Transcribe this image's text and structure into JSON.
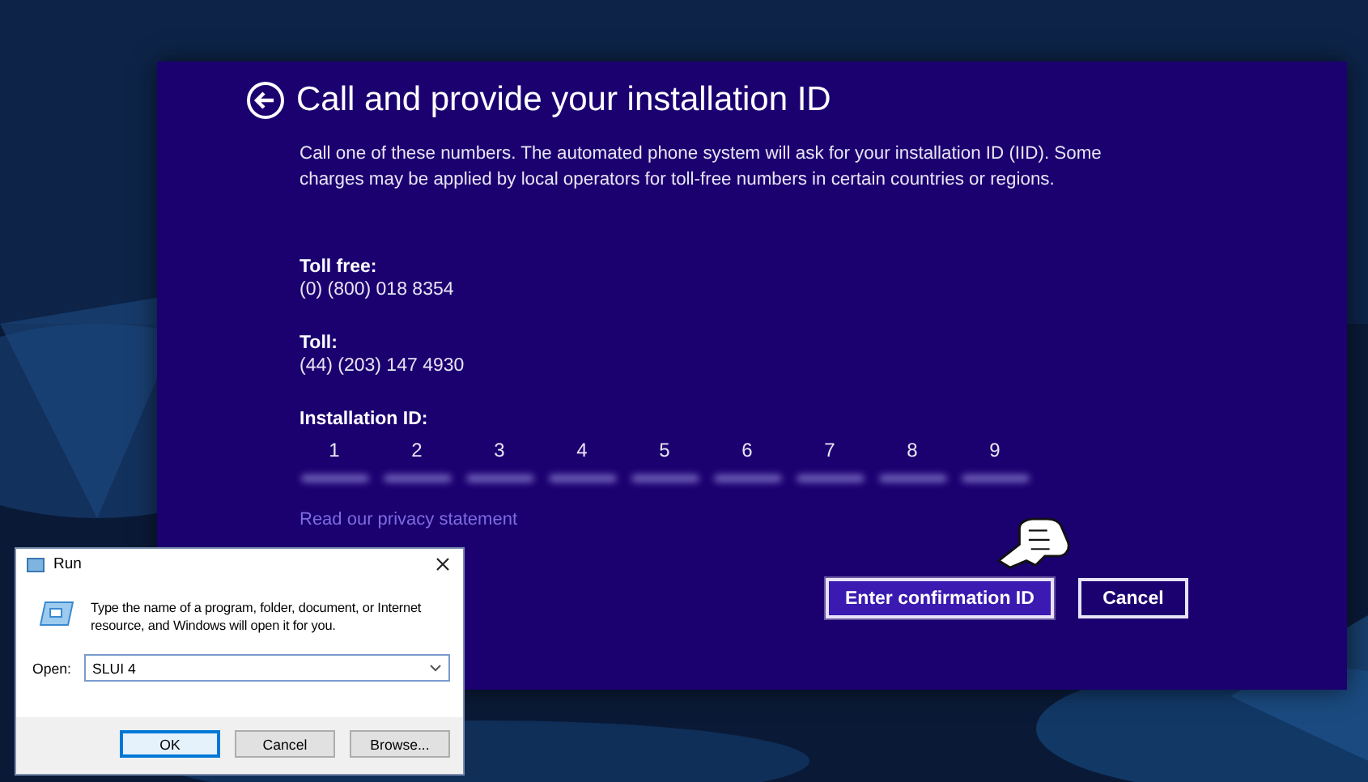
{
  "activation_window": {
    "title": "Call and provide your installation ID",
    "description": "Call one of these numbers. The automated phone system will ask for your installation ID (IID). Some charges may be applied by local operators for toll-free numbers in certain countries or regions.",
    "phone_numbers": [
      {
        "label": "Toll free:",
        "number": "(0) (800) 018 8354"
      },
      {
        "label": "Toll:",
        "number": "(44) (203) 147 4930"
      }
    ],
    "installation_id": {
      "label": "Installation ID:",
      "groups": [
        "1",
        "2",
        "3",
        "4",
        "5",
        "6",
        "7",
        "8",
        "9"
      ]
    },
    "privacy_link": "Read our privacy statement",
    "buttons": [
      {
        "label": "Enter confirmation ID",
        "focused": true
      },
      {
        "label": "Cancel",
        "focused": false
      }
    ]
  },
  "run_dialog": {
    "title": "Run",
    "description": "Type the name of a program, folder, document, or Internet resource, and Windows will open it for you.",
    "open_label": "Open:",
    "value": "SLUI 4",
    "buttons": [
      {
        "label": "OK",
        "focused": true
      },
      {
        "label": "Cancel",
        "focused": false
      },
      {
        "label": "Browse...",
        "focused": false
      }
    ]
  }
}
